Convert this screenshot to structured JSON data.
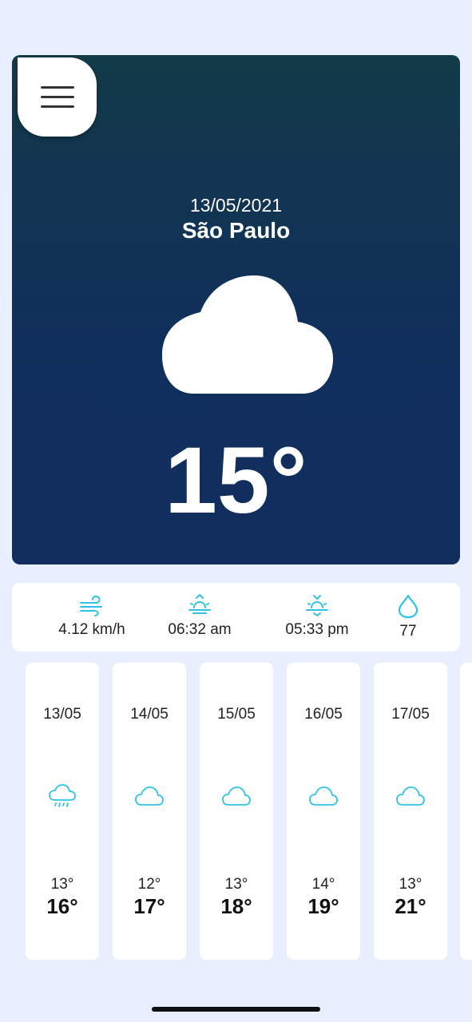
{
  "header": {
    "date": "13/05/2021",
    "city": "São Paulo",
    "temperature": "15°",
    "condition_icon": "cloud-icon"
  },
  "stats": {
    "wind": "4.12 km/h",
    "sunrise": "06:32 am",
    "sunset": "05:33 pm",
    "humidity": "77"
  },
  "forecast": [
    {
      "date": "13/05",
      "icon": "rain-cloud-icon",
      "min": "13°",
      "max": "16°"
    },
    {
      "date": "14/05",
      "icon": "cloud-icon",
      "min": "12°",
      "max": "17°"
    },
    {
      "date": "15/05",
      "icon": "cloud-icon",
      "min": "13°",
      "max": "18°"
    },
    {
      "date": "16/05",
      "icon": "cloud-icon",
      "min": "14°",
      "max": "19°"
    },
    {
      "date": "17/05",
      "icon": "cloud-icon",
      "min": "13°",
      "max": "21°"
    }
  ],
  "colors": {
    "accent": "#2ec3e6",
    "hero_top": "#123a48",
    "hero_bottom": "#112e5f",
    "background": "#e9efff"
  }
}
